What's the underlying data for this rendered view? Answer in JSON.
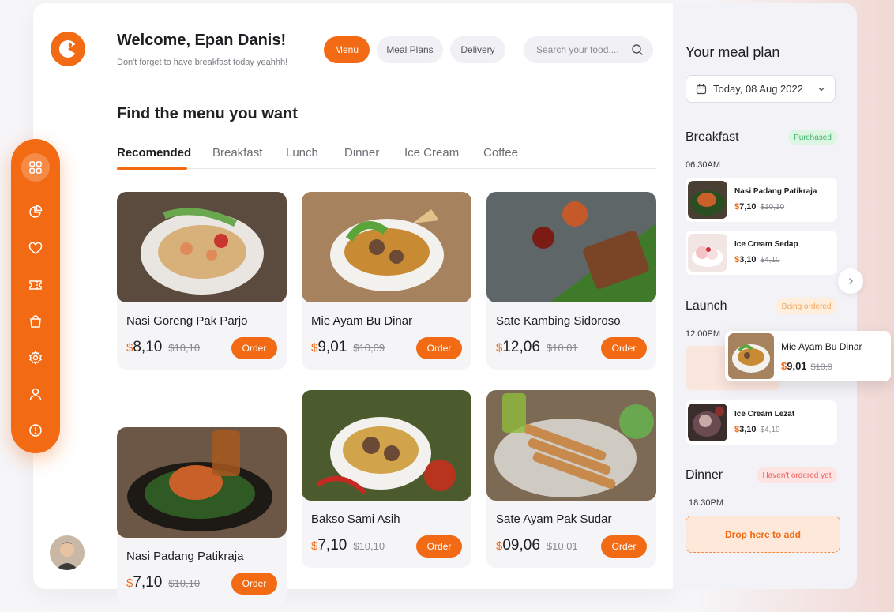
{
  "header": {
    "title": "Welcome, Epan Danis!",
    "subtitle": "Don't forget to have breakfast today yeahhh!",
    "nav": [
      "Menu",
      "Meal Plans",
      "Delivery"
    ],
    "search_placeholder": "Search your food...."
  },
  "main": {
    "section_title": "Find the menu you want",
    "tabs": [
      "Recomended",
      "Breakfast",
      "Lunch",
      "Dinner",
      "Ice Cream",
      "Coffee"
    ],
    "order_label": "Order",
    "currency": "$",
    "cards": [
      {
        "name": "Nasi Goreng Pak Parjo",
        "price": "8,10",
        "old_price": "$10,10"
      },
      {
        "name": "Mie Ayam Bu Dinar",
        "price": "9,01",
        "old_price": "$10,09"
      },
      {
        "name": "Sate Kambing Sidoroso",
        "price": "12,06",
        "old_price": "$10,01"
      },
      {
        "name": "Nasi Padang Patikraja",
        "price": "7,10",
        "old_price": "$10,10"
      },
      {
        "name": "Bakso Sami Asih",
        "price": "7,10",
        "old_price": "$10,10"
      },
      {
        "name": "Sate Ayam Pak Sudar",
        "price": "09,06",
        "old_price": "$10,01"
      }
    ]
  },
  "sidebar": {
    "icons": [
      "grid-icon",
      "chart-pie-icon",
      "heart-icon",
      "ticket-icon",
      "bag-icon",
      "gear-icon",
      "user-icon",
      "info-icon"
    ]
  },
  "meal_plan": {
    "title": "Your meal plan",
    "date": "Today, 08 Aug 2022",
    "breakfast": {
      "label": "Breakfast",
      "status": "Purchased",
      "time": "06.30AM",
      "items": [
        {
          "name": "Nasi Padang Patikraja",
          "price": "7,10",
          "old_price": "$10,10"
        },
        {
          "name": "Ice Cream Sedap",
          "price": "3,10",
          "old_price": "$4,10"
        }
      ]
    },
    "lunch": {
      "label": "Launch",
      "status": "Being ordered",
      "time": "12.00PM",
      "dragging": {
        "name": "Mie Ayam Bu Dinar",
        "price": "9,01",
        "old_price": "$10,9"
      },
      "items": [
        {
          "name": "Ice Cream Lezat",
          "price": "3,10",
          "old_price": "$4,10"
        }
      ]
    },
    "dinner": {
      "label": "Dinner",
      "status": "Haven't ordered yet",
      "time": "18.30PM",
      "drop_label": "Drop here to add"
    }
  },
  "colors": {
    "accent": "#f26b14",
    "purchased": "#3bb56a",
    "ordering": "#f0a75c",
    "not_ordered": "#ef5f5f"
  }
}
